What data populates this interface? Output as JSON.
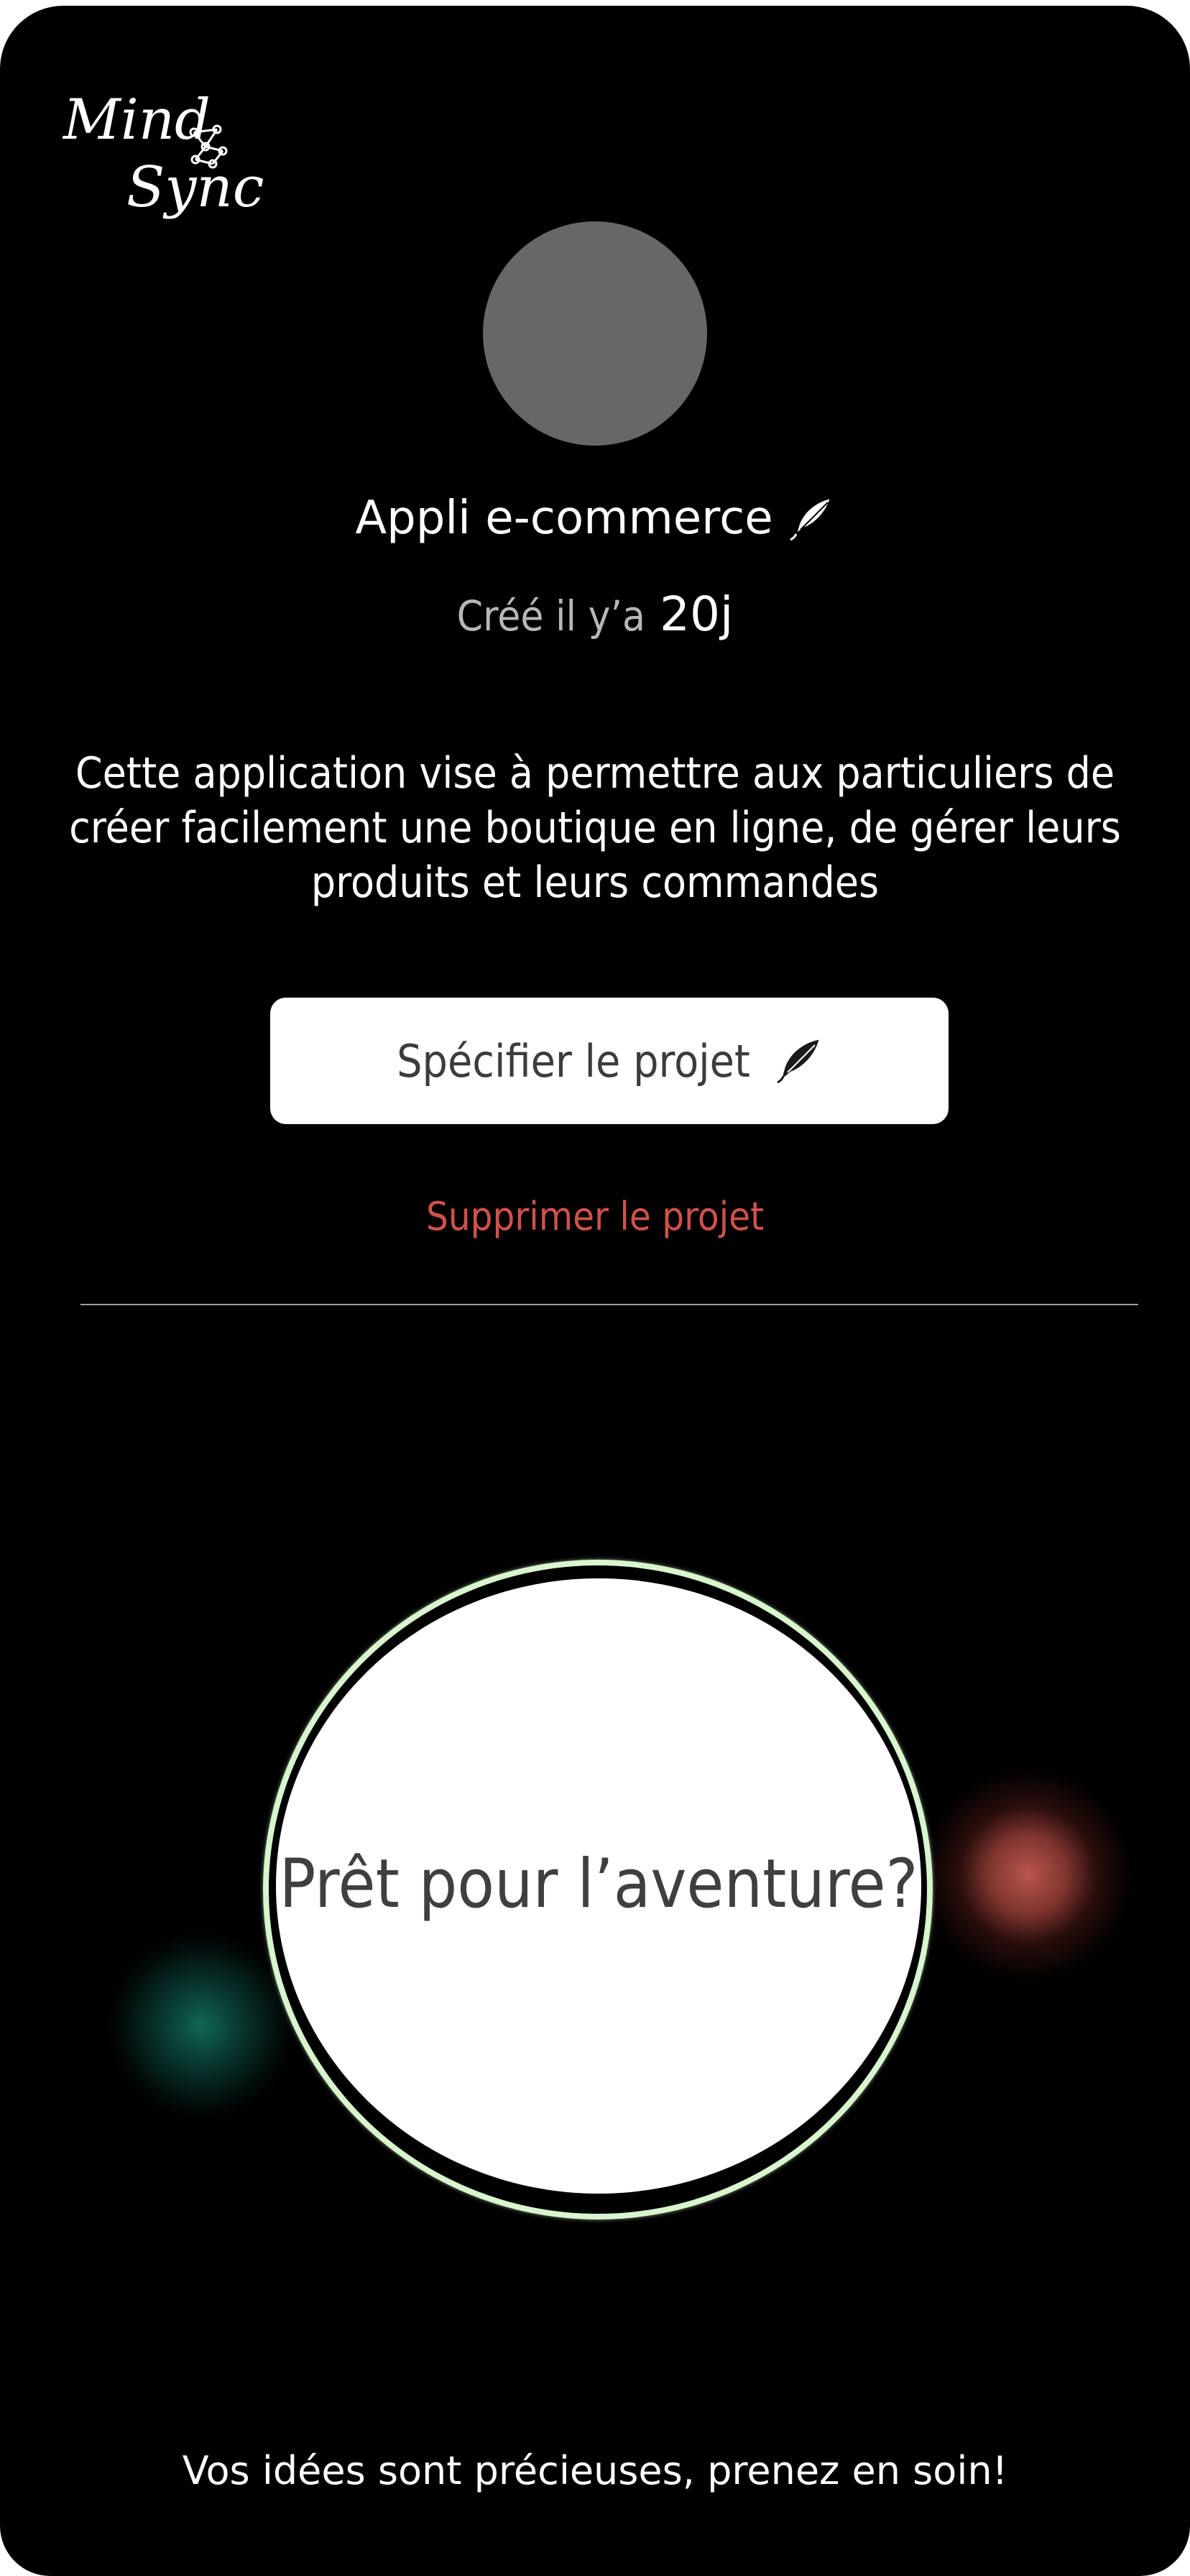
{
  "app": {
    "logo_line1": "Mind",
    "logo_line2": "Sync",
    "logo_icon": "network-nodes-icon"
  },
  "project": {
    "title": "Appli e-commerce",
    "edit_icon": "quill-icon",
    "created_label": "Créé il y’a",
    "created_value": "20j",
    "description": "Cette application vise à permettre aux particuliers de créer facilement une boutique en ligne, de gérer leurs produits  et leurs commandes"
  },
  "actions": {
    "specify_label": "Spécifier le projet",
    "delete_label": "Supprimer le projet"
  },
  "cta": {
    "label": "Prêt pour l’aventure?"
  },
  "footer": {
    "text": "Vos idées sont précieuses, prenez en soin!"
  },
  "colors": {
    "background": "#000000",
    "avatar_placeholder": "#676767",
    "delete_red": "#d0524b",
    "ring_green": "#d8f5cd",
    "glow_teal": "#147864",
    "glow_red": "#cd5f56"
  }
}
